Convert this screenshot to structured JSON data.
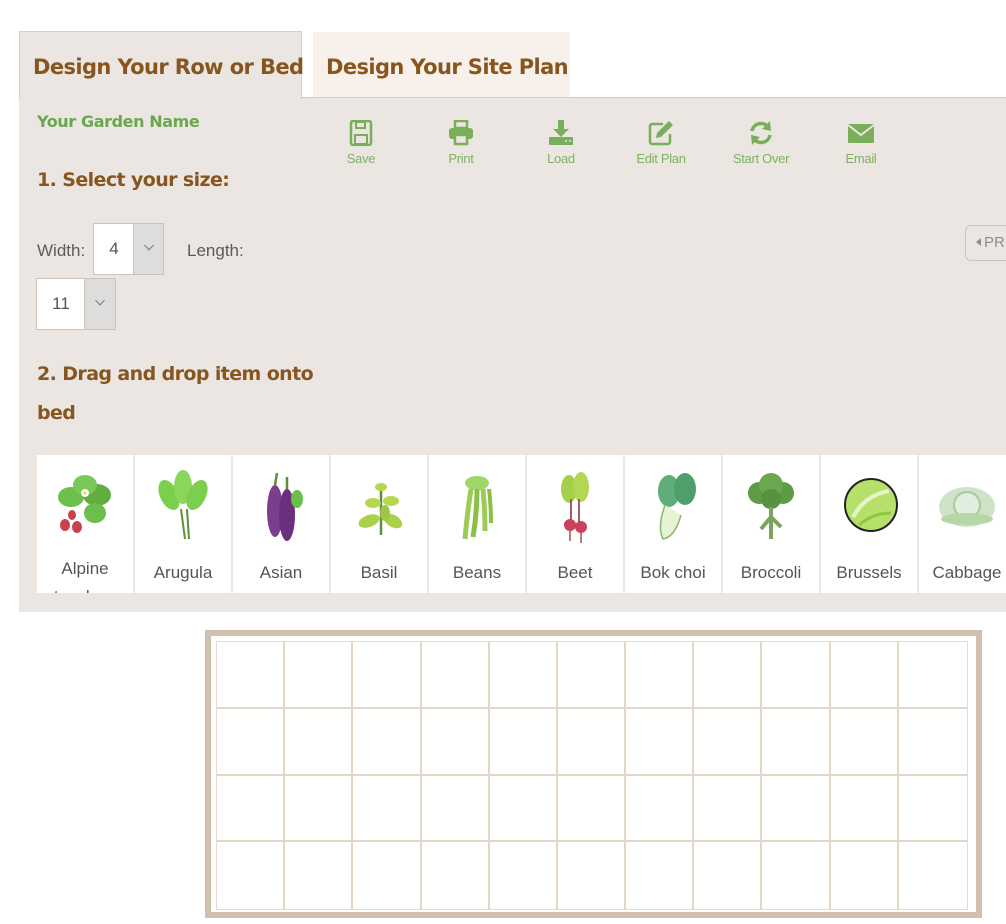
{
  "tabs": [
    {
      "label": "Design Your Row or Bed",
      "active": true
    },
    {
      "label": "Design Your Site Plan",
      "active": false
    }
  ],
  "garden_name": "Your Garden Name",
  "step1": {
    "title": "1. Select your size:",
    "width_label": "Width:",
    "width_value": "4",
    "length_label": "Length:",
    "length_value": "11"
  },
  "step2": {
    "title": "2. Drag and drop item onto bed"
  },
  "toolbar": [
    {
      "label": "Save",
      "icon": "save-icon"
    },
    {
      "label": "Print",
      "icon": "print-icon"
    },
    {
      "label": "Load",
      "icon": "download-icon"
    },
    {
      "label": "Edit Plan",
      "icon": "edit-icon"
    },
    {
      "label": "Start Over",
      "icon": "refresh-icon"
    },
    {
      "label": "Email",
      "icon": "envelope-icon"
    }
  ],
  "prev_button": {
    "label": "PR"
  },
  "plants": [
    {
      "name": "Alpine strawberry"
    },
    {
      "name": "Arugula"
    },
    {
      "name": "Asian"
    },
    {
      "name": "Basil"
    },
    {
      "name": "Beans"
    },
    {
      "name": "Beet"
    },
    {
      "name": "Bok choi"
    },
    {
      "name": "Broccoli"
    },
    {
      "name": "Brussels"
    },
    {
      "name": "Cabbage"
    }
  ],
  "bed": {
    "rows": 4,
    "columns": 11
  },
  "colors": {
    "brown": "#87561f",
    "green": "#6aa84f",
    "panel": "#ebe6e1",
    "bed_border": "#d0c0ad"
  }
}
